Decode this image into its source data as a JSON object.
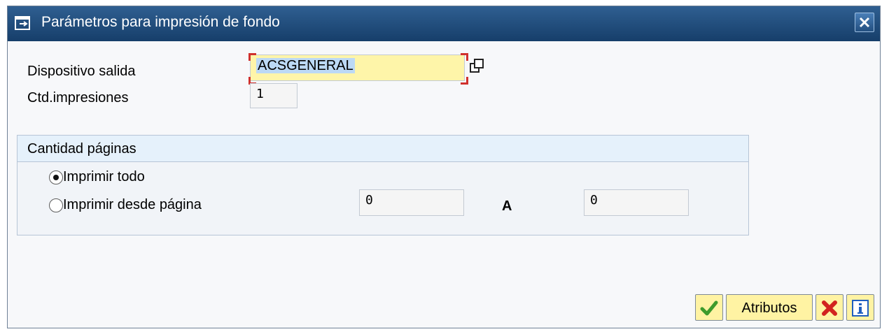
{
  "dialog": {
    "title": "Parámetros para impresión de fondo"
  },
  "fields": {
    "output_device_label": "Dispositivo salida",
    "output_device_value": "ACSGENERAL",
    "copies_label": "Ctd.impresiones",
    "copies_value": "1"
  },
  "pages_group": {
    "title": "Cantidad páginas",
    "print_all_label": "Imprimir todo",
    "print_from_label": "Imprimir desde página",
    "from_value": "0",
    "to_label": "A",
    "to_value": "0",
    "selected": "print_all"
  },
  "buttons": {
    "attributes_label": "Atributos"
  }
}
